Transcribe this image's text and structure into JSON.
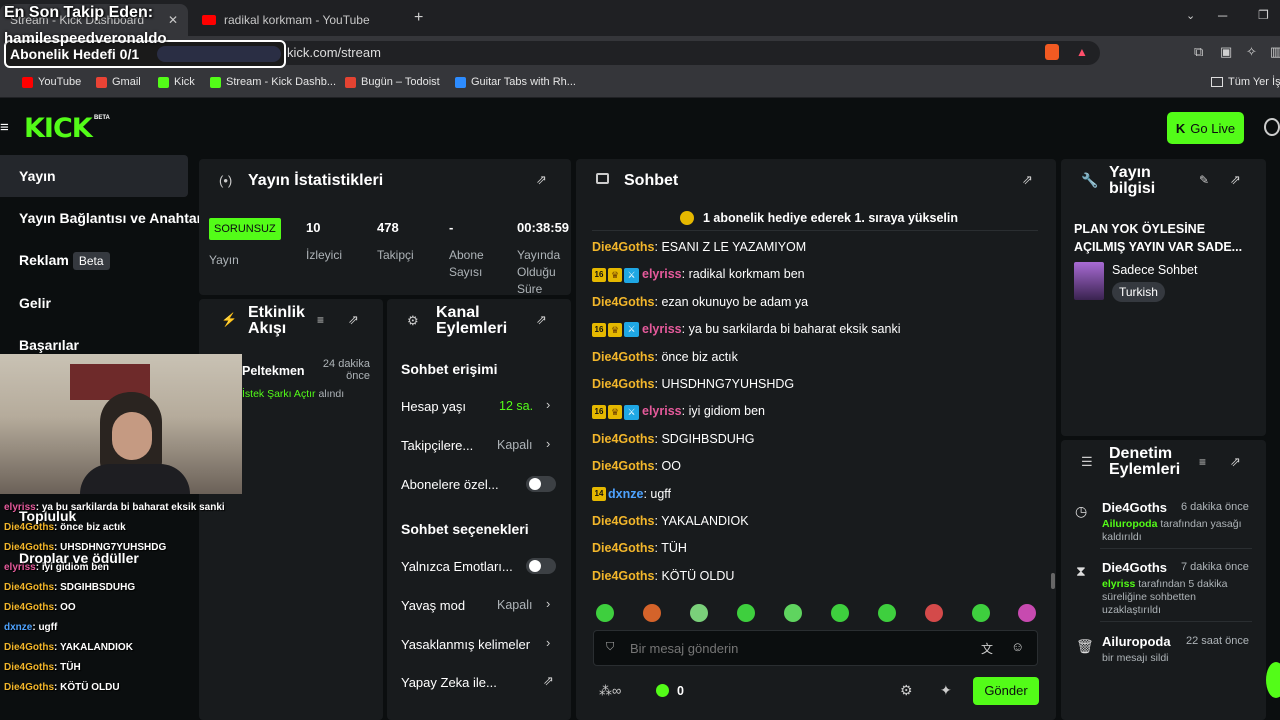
{
  "browser": {
    "tabs": [
      {
        "title": "Stream - Kick Dashboard",
        "active": true
      },
      {
        "title": "radikal korkmam - YouTube",
        "active": false
      }
    ],
    "url": "kick.com/stream",
    "bookmarks": [
      "YouTube",
      "Gmail",
      "Kick",
      "Stream - Kick Dashb...",
      "Bugün – Todoist",
      "Guitar Tabs with Rh...",
      "Tüm Yer İş"
    ]
  },
  "overlay": {
    "latest_follower_label": "En Son Takip Eden:",
    "latest_follower": "hamilespeedveronaldo",
    "sub_goal": "Abonelik Hedefi 0/1",
    "chat": [
      {
        "user": "elyriss",
        "text": "ya bu sarkilarda bi baharat eksik sanki"
      },
      {
        "user": "Die4Goths",
        "text": "önce biz actık"
      },
      {
        "user": "Die4Goths",
        "text": "UHSDHNG7YUHSHDG"
      },
      {
        "user": "elyriss",
        "text": "iyi gidiom ben"
      },
      {
        "user": "Die4Goths",
        "text": "SDGIHBSDUHG"
      },
      {
        "user": "Die4Goths",
        "text": "OO"
      },
      {
        "user": "dxnze",
        "text": "ugff"
      },
      {
        "user": "Die4Goths",
        "text": "YAKALANDIOK"
      },
      {
        "user": "Die4Goths",
        "text": "TÜH"
      },
      {
        "user": "Die4Goths",
        "text": "KÖTÜ OLDU"
      }
    ]
  },
  "kick": {
    "logo": "KICK",
    "logo_badge": "BETA",
    "go_live": "Go Live",
    "sidebar": [
      "Yayın",
      "Yayın Bağlantısı ve Anahtar",
      "Reklam",
      "Gelir",
      "Başarılar",
      "Topluluk",
      "Droplar ve ödüller"
    ],
    "sidebar_beta": "Beta",
    "stats": {
      "title": "Yayın İstatistikleri",
      "status": "SORUNSUZ",
      "status_label": "Yayın",
      "viewers": "10",
      "viewers_label": "İzleyici",
      "followers": "478",
      "followers_label": "Takipçi",
      "subs": "-",
      "subs_label": "Abone Sayısı",
      "uptime": "00:38:59",
      "uptime_label": "Yayında Olduğu Süre"
    },
    "activity": {
      "title": "Etkinlik Akışı",
      "user": "Peltekmen",
      "time": "24 dakika önce",
      "reward": "İstek Şarkı Açtır",
      "reward_suffix": "alındı"
    },
    "channel": {
      "title": "Kanal Eylemleri",
      "chat_access": "Sohbet erişimi",
      "account_age": "Hesap yaşı",
      "account_age_val": "12 sa.",
      "followers_only": "Takipçilere...",
      "followers_only_val": "Kapalı",
      "subs_only": "Abonelere özel...",
      "chat_options": "Sohbet seçenekleri",
      "emotes_only": "Yalnızca Emotları...",
      "slow_mode": "Yavaş mod",
      "slow_mode_val": "Kapalı",
      "banned_words": "Yasaklanmış kelimeler",
      "ai": "Yapay Zeka ile..."
    },
    "chat": {
      "title": "Sohbet",
      "pinned": "1 abonelik hediye ederek 1. sıraya yükselin",
      "messages": [
        {
          "user": "Die4Goths",
          "text": "ESANI Z LE YAZAMIYOM",
          "badges": false,
          "color": "orange"
        },
        {
          "user": "elyriss",
          "text": "radikal korkmam ben",
          "badges": true,
          "color": "pink"
        },
        {
          "user": "Die4Goths",
          "text": "ezan okunuyo be adam ya",
          "badges": false,
          "color": "orange"
        },
        {
          "user": "elyriss",
          "text": "ya bu sarkilarda bi baharat eksik sanki",
          "badges": true,
          "color": "pink"
        },
        {
          "user": "Die4Goths",
          "text": "önce biz actık",
          "badges": false,
          "color": "orange"
        },
        {
          "user": "Die4Goths",
          "text": "UHSDHNG7YUHSHDG",
          "badges": false,
          "color": "orange"
        },
        {
          "user": "elyriss",
          "text": "iyi gidiom ben",
          "badges": true,
          "color": "pink"
        },
        {
          "user": "Die4Goths",
          "text": "SDGIHBSDUHG",
          "badges": false,
          "color": "orange"
        },
        {
          "user": "Die4Goths",
          "text": "OO",
          "badges": false,
          "color": "orange"
        },
        {
          "user": "dxnze",
          "text": "ugff",
          "badges": false,
          "color": "blue"
        },
        {
          "user": "Die4Goths",
          "text": "YAKALANDIOK",
          "badges": false,
          "color": "orange"
        },
        {
          "user": "Die4Goths",
          "text": "TÜH",
          "badges": false,
          "color": "orange"
        },
        {
          "user": "Die4Goths",
          "text": "KÖTÜ OLDU",
          "badges": false,
          "color": "orange"
        }
      ],
      "placeholder": "Bir mesaj gönderin",
      "points": "0",
      "send": "Gönder"
    },
    "info": {
      "title": "Yayın bilgisi",
      "stream_title": "PLAN YOK ÖYLESİNE AÇILMIŞ YAYIN VAR SADE...",
      "category": "Sadece Sohbet",
      "language": "Turkish"
    },
    "moderation": {
      "title": "Denetim Eylemleri",
      "items": [
        {
          "user": "Die4Goths",
          "time": "6 dakika önce",
          "actor": "Ailuropoda",
          "text": "tarafından yasağı kaldırıldı"
        },
        {
          "user": "Die4Goths",
          "time": "7 dakika önce",
          "actor": "elyriss",
          "text": "tarafından 5 dakika süreliğine sohbetten uzaklaştırıldı"
        },
        {
          "user": "Ailuropoda",
          "time": "22 saat önce",
          "actor": "",
          "text": "bir mesajı sildi"
        }
      ]
    }
  },
  "colors": {
    "accent": "#53fc18",
    "panel": "#181b1d",
    "bg": "#0b0e0f"
  }
}
